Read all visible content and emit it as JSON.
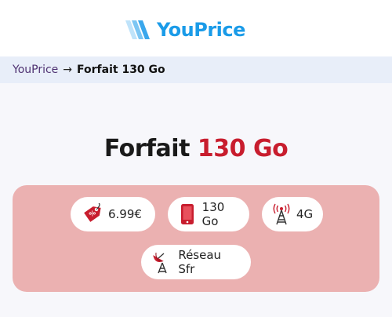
{
  "header": {
    "logo_text": "YouPrice"
  },
  "breadcrumb": {
    "home": "YouPrice",
    "separator": "→",
    "current": "Forfait 130 Go"
  },
  "page": {
    "title_prefix": "Forfait",
    "title_accent": "130 Go"
  },
  "features": {
    "price": {
      "label": "6.99€",
      "icon": "price-tag-icon"
    },
    "data": {
      "label": "130 Go",
      "icon": "smartphone-icon"
    },
    "network": {
      "label": "4G",
      "icon": "antenna-tower-icon"
    },
    "carrier": {
      "label": "Réseau Sfr",
      "icon": "satellite-dish-icon"
    }
  },
  "colors": {
    "accent": "#c81d2e",
    "brand": "#1a9be8",
    "panel": "#ebb1b1",
    "breadcrumb_bg": "#e8eef9"
  }
}
